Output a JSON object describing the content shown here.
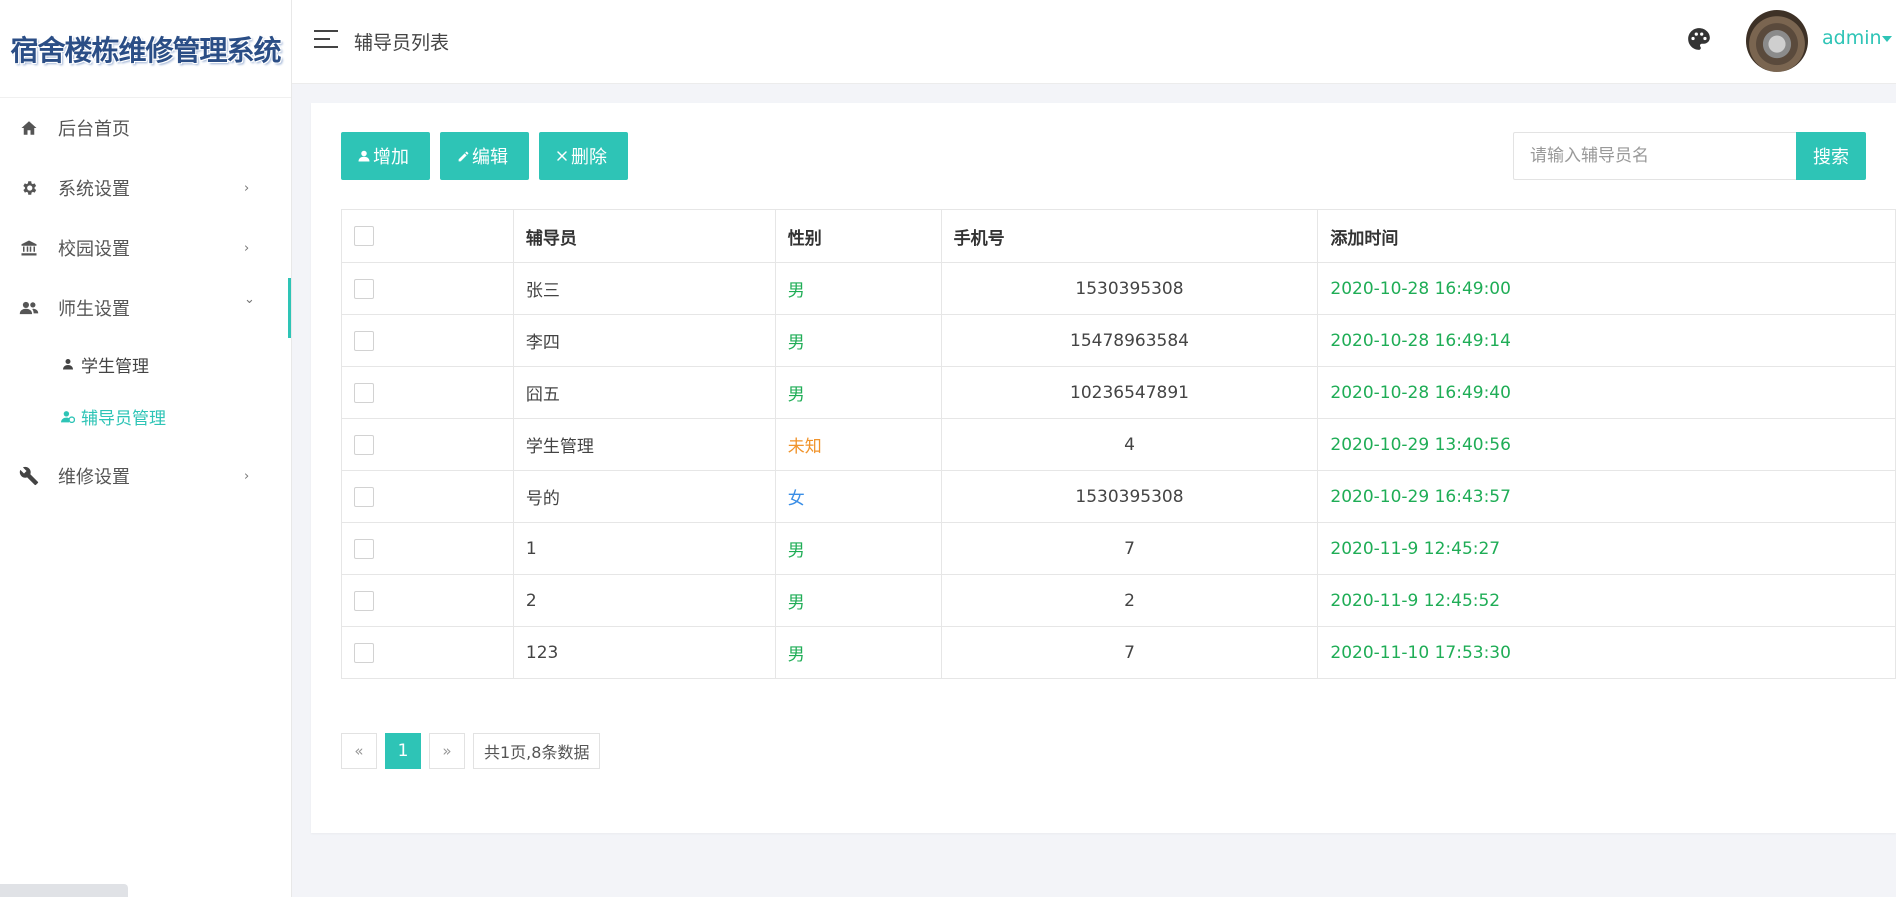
{
  "app": {
    "title": "宿舍楼栋维修管理系统"
  },
  "sidebar": {
    "items": [
      {
        "label": "后台首页",
        "icon": "home-icon"
      },
      {
        "label": "系统设置",
        "icon": "gear-icon",
        "arrow": "›"
      },
      {
        "label": "校园设置",
        "icon": "bank-icon",
        "arrow": "›"
      },
      {
        "label": "师生设置",
        "icon": "users-icon",
        "arrow": "⌄",
        "children": [
          {
            "label": "学生管理",
            "icon": "user-icon"
          },
          {
            "label": "辅导员管理",
            "icon": "user-gear-icon",
            "active": true
          }
        ]
      },
      {
        "label": "维修设置",
        "icon": "wrench-icon",
        "arrow": "›"
      }
    ]
  },
  "header": {
    "page_title": "辅导员列表",
    "user_name": "admin"
  },
  "toolbar": {
    "add_label": "增加",
    "edit_label": "编辑",
    "delete_label": "删除",
    "search_placeholder": "请输入辅导员名",
    "search_label": "搜索"
  },
  "table": {
    "columns": [
      "",
      "辅导员",
      "性别",
      "手机号",
      "添加时间"
    ],
    "rows": [
      {
        "name": "张三",
        "gender": "男",
        "phone": "1530395308",
        "time": "2020-10-28 16:49:00"
      },
      {
        "name": "李四",
        "gender": "男",
        "phone": "15478963584",
        "time": "2020-10-28 16:49:14"
      },
      {
        "name": "囧五",
        "gender": "男",
        "phone": "10236547891",
        "time": "2020-10-28 16:49:40"
      },
      {
        "name": "学生管理",
        "gender": "未知",
        "phone": "4",
        "time": "2020-10-29 13:40:56"
      },
      {
        "name": "号的",
        "gender": "女",
        "phone": "1530395308",
        "time": "2020-10-29 16:43:57"
      },
      {
        "name": "1",
        "gender": "男",
        "phone": "7",
        "time": "2020-11-9 12:45:27"
      },
      {
        "name": "2",
        "gender": "男",
        "phone": "2",
        "time": "2020-11-9 12:45:52"
      },
      {
        "name": "123",
        "gender": "男",
        "phone": "7",
        "time": "2020-11-10 17:53:30"
      }
    ]
  },
  "pagination": {
    "prev": "«",
    "current": "1",
    "next": "»",
    "info": "共1页,8条数据"
  },
  "colors": {
    "accent": "#2ec4b6",
    "time_green": "#1fad56",
    "male": "#1fad56",
    "female": "#3a8ee6",
    "unknown": "#f0932b",
    "logo_blue": "#2b4e86"
  }
}
